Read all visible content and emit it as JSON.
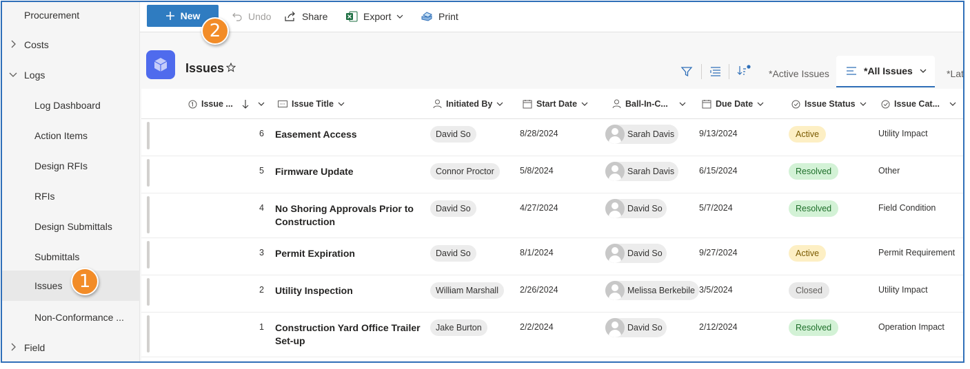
{
  "sidebar": {
    "items": [
      {
        "label": "Procurement"
      },
      {
        "label": "Costs"
      },
      {
        "label": "Logs"
      },
      {
        "label": "Log Dashboard"
      },
      {
        "label": "Action Items"
      },
      {
        "label": "Design RFIs"
      },
      {
        "label": "RFIs"
      },
      {
        "label": "Design Submittals"
      },
      {
        "label": "Submittals"
      },
      {
        "label": "Issues"
      },
      {
        "label": "Non-Conformance ..."
      },
      {
        "label": "Field"
      }
    ]
  },
  "toolbar": {
    "new_label": "New",
    "undo_label": "Undo",
    "share_label": "Share",
    "export_label": "Export",
    "print_label": "Print"
  },
  "callouts": {
    "one": "1",
    "two": "2"
  },
  "page": {
    "title": "Issues"
  },
  "views": {
    "active_issues": "*Active Issues",
    "all_issues": "*All Issues",
    "latest": "*Late"
  },
  "columns": {
    "issue_num": "Issue ...",
    "issue_title": "Issue Title",
    "initiated_by": "Initiated By",
    "start_date": "Start Date",
    "ball_in_court": "Ball-In-C...",
    "due_date": "Due Date",
    "issue_status": "Issue Status",
    "issue_category": "Issue Cat..."
  },
  "rows": [
    {
      "num": "6",
      "title": "Easement Access",
      "initiated_by": "David So",
      "start_date": "8/28/2024",
      "ball_in_court": "Sarah Davis",
      "due_date": "9/13/2024",
      "status": "Active",
      "category": "Utility Impact"
    },
    {
      "num": "5",
      "title": "Firmware Update",
      "initiated_by": "Connor Proctor",
      "start_date": "5/8/2024",
      "ball_in_court": "Sarah Davis",
      "due_date": "6/15/2024",
      "status": "Resolved",
      "category": "Other"
    },
    {
      "num": "4",
      "title": "No Shoring Approvals Prior to Construction",
      "initiated_by": "David So",
      "start_date": "4/27/2024",
      "ball_in_court": "David So",
      "due_date": "5/7/2024",
      "status": "Resolved",
      "category": "Field Condition"
    },
    {
      "num": "3",
      "title": "Permit Expiration",
      "initiated_by": "David So",
      "start_date": "8/1/2024",
      "ball_in_court": "David So",
      "due_date": "9/27/2024",
      "status": "Active",
      "category": "Permit Requirement"
    },
    {
      "num": "2",
      "title": "Utility Inspection",
      "initiated_by": "William Marshall",
      "start_date": "2/26/2024",
      "ball_in_court": "Melissa Berkebile",
      "due_date": "3/5/2024",
      "status": "Closed",
      "category": "Utility Impact"
    },
    {
      "num": "1",
      "title": "Construction Yard Office Trailer Set-up",
      "initiated_by": "Jake Burton",
      "start_date": "2/2/2024",
      "ball_in_court": "David So",
      "due_date": "2/12/2024",
      "status": "Resolved",
      "category": "Operation Impact"
    }
  ],
  "colors": {
    "accent": "#2f7cc1",
    "callout": "#f28c28",
    "frame": "#2f6fb8"
  }
}
